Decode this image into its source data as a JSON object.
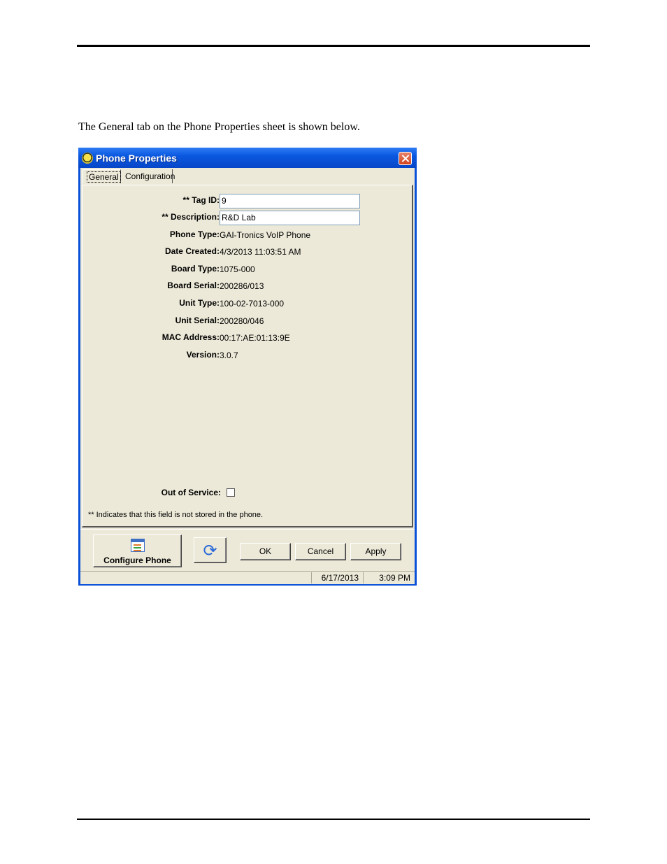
{
  "page": {
    "intro_text": "The General tab on the Phone Properties sheet is shown below."
  },
  "window": {
    "title": "Phone Properties",
    "app_icon": "phone-app-icon",
    "close_icon": "close-icon"
  },
  "tabs": [
    {
      "label": "General",
      "selected": true
    },
    {
      "label": "Configuration",
      "selected": false
    }
  ],
  "fields": {
    "tag_id": {
      "label": "** Tag ID:",
      "value": "9"
    },
    "description": {
      "label": "** Description:",
      "value": "R&D Lab"
    },
    "phone_type": {
      "label": "Phone Type:",
      "value": "GAI-Tronics VoIP Phone"
    },
    "date_created": {
      "label": "Date Created:",
      "value": "4/3/2013 11:03:51 AM"
    },
    "board_type": {
      "label": "Board Type:",
      "value": "1075-000"
    },
    "board_serial": {
      "label": "Board Serial:",
      "value": "200286/013"
    },
    "unit_type": {
      "label": "Unit Type:",
      "value": "100-02-7013-000"
    },
    "unit_serial": {
      "label": "Unit Serial:",
      "value": "200280/046"
    },
    "mac_address": {
      "label": "MAC Address:",
      "value": "00:17:AE:01:13:9E"
    },
    "version": {
      "label": "Version:",
      "value": "3.0.7"
    },
    "out_of_service": {
      "label": "Out of Service:",
      "checked": false
    }
  },
  "footnote": "** Indicates that this field is not stored in the phone.",
  "buttons": {
    "configure_phone": "Configure Phone",
    "refresh_icon": "refresh-icon",
    "ok": "OK",
    "cancel": "Cancel",
    "apply": "Apply"
  },
  "status": {
    "date": "6/17/2013",
    "time": "3:09 PM"
  },
  "colors": {
    "titlebar": "#0a58e0",
    "window_bg": "#ece9d8"
  }
}
